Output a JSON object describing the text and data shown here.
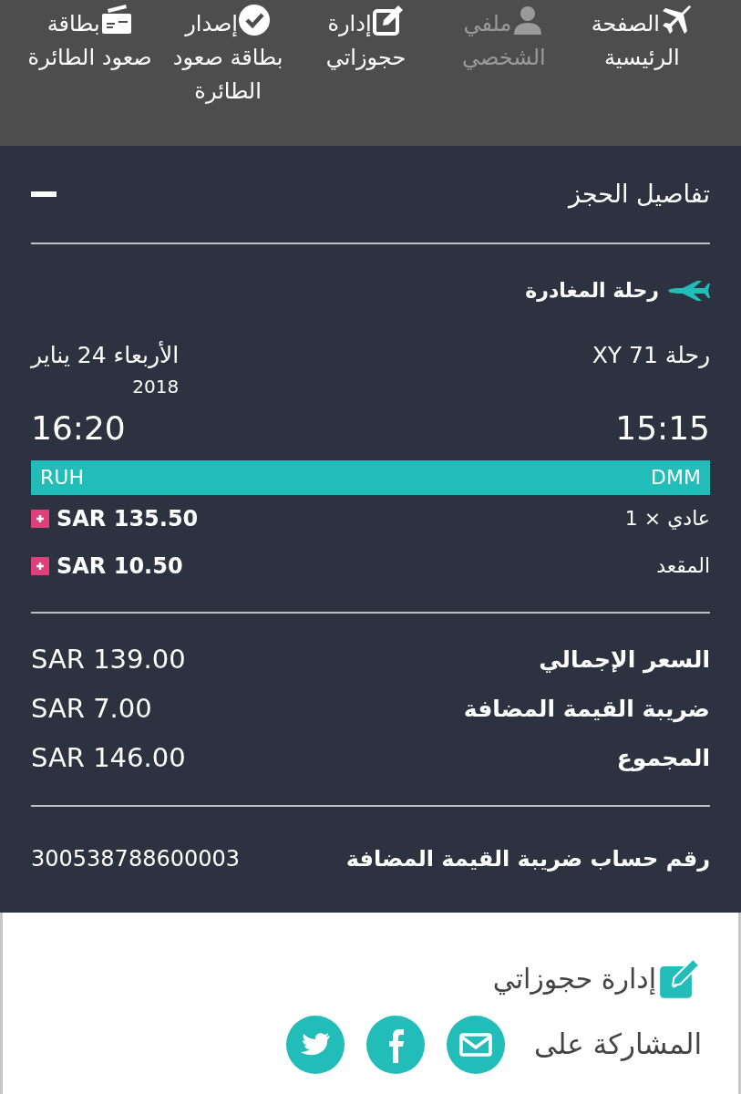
{
  "nav_items": [
    {
      "kind": "home",
      "label": "الصفحة الرئيسية",
      "disabled": false
    },
    {
      "kind": "profile",
      "label": "ملفي الشخصي",
      "disabled": true
    },
    {
      "kind": "manage",
      "label": "إدارة حجوزاتي",
      "disabled": false
    },
    {
      "kind": "checkin",
      "label": "إصدار بطاقة صعود الطائرة",
      "disabled": false
    },
    {
      "kind": "boarding",
      "label": "بطاقة صعود الطائرة",
      "disabled": false
    }
  ],
  "booking_details": {
    "title": "تفاصيل الحجز",
    "expanded": true,
    "departure": {
      "heading": "رحلة المغادرة",
      "flight": "رحلة XY 71",
      "date": "الأربعاء 24 يناير",
      "year": "2018",
      "departure_time": "15:15",
      "arrival_time": "16:20",
      "origin": "DMM",
      "destination": "RUH",
      "charges": [
        {
          "label": "عادي × 1",
          "amount": "SAR 135.50"
        },
        {
          "label": "المقعد",
          "amount": "SAR 10.50"
        }
      ]
    },
    "totals": [
      {
        "label": "السعر الإجمالي",
        "amount": "SAR 139.00"
      },
      {
        "label": "ضريبة القيمة المضافة",
        "amount": "SAR 7.00"
      },
      {
        "label": "المجموع",
        "amount": "SAR 146.00"
      }
    ],
    "vat_number": {
      "label": "رقم حساب ضريبة القيمة المضافة",
      "value": "300538788600003"
    }
  },
  "footer": {
    "manage_link": "إدارة حجوزاتي",
    "share_label": "المشاركة على",
    "share_buttons": [
      {
        "kind": "email"
      },
      {
        "kind": "facebook"
      },
      {
        "kind": "twitter"
      }
    ]
  }
}
